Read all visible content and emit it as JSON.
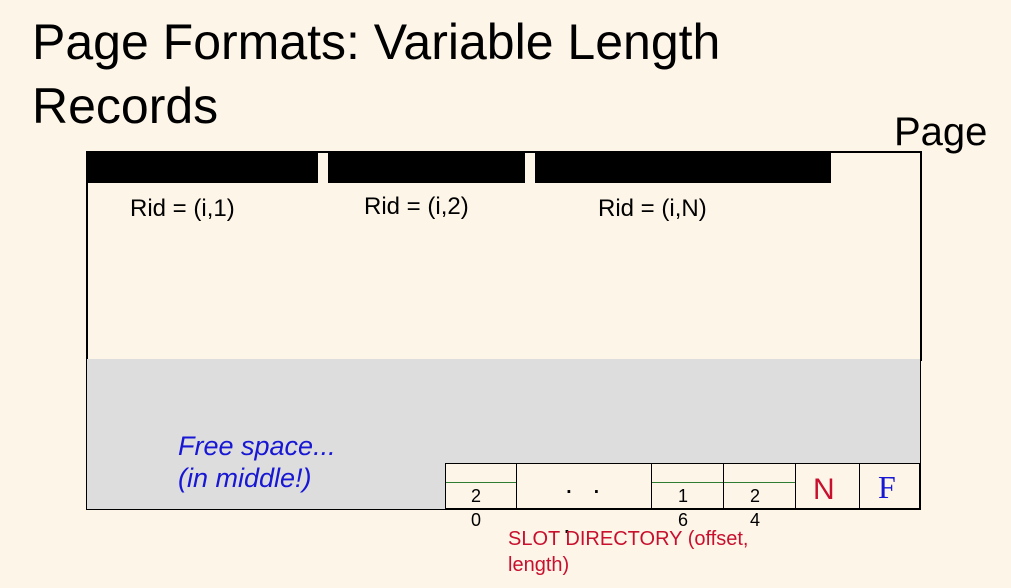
{
  "title": "Page Formats: Variable Length Records",
  "page_label": "Page",
  "page_id": "i",
  "rids": [
    "Rid = (i,1)",
    "Rid = (i,2)",
    "Rid = (i,N)"
  ],
  "free_space": {
    "line1": "Free space...",
    "line2": "(in middle!)"
  },
  "slot_directory": {
    "label": "SLOT DIRECTORY (offset, length)",
    "entry1": {
      "top": "2",
      "bottom": "0"
    },
    "ellipsis": ". .",
    "ellipsis_below": ".",
    "entry2": {
      "top": "1",
      "bottom": "6"
    },
    "entry3": {
      "top": "2",
      "bottom": "4"
    },
    "n_label": "N",
    "f_label": "F"
  },
  "colors": {
    "background": "#fdf5e8",
    "free_space_fill": "#dddddd",
    "free_space_text": "#1717d4",
    "slot_label": "#c8102e",
    "slot_divider": "#2e7d32",
    "record_fill": "#000000"
  }
}
